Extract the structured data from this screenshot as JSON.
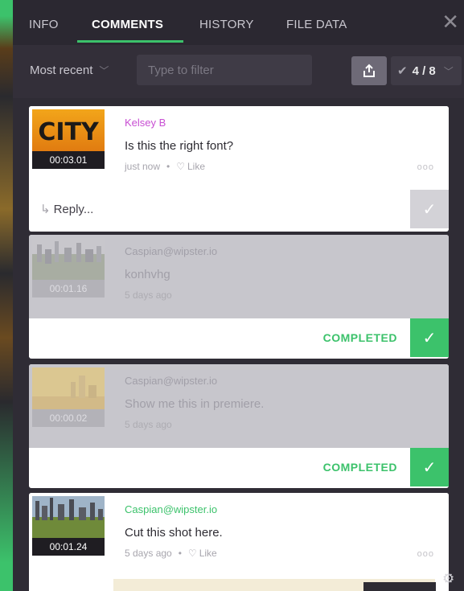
{
  "tabs": [
    {
      "label": "INFO",
      "active": false
    },
    {
      "label": "COMMENTS",
      "active": true
    },
    {
      "label": "HISTORY",
      "active": false
    },
    {
      "label": "FILE DATA",
      "active": false
    }
  ],
  "close_icon": "close-icon",
  "filter": {
    "sort_label": "Most recent",
    "placeholder": "Type to filter",
    "counter": "4 / 8"
  },
  "comments": [
    {
      "author": "Kelsey B",
      "author_color": "#c84fd3",
      "text": "Is this the right font?",
      "timecode": "00:03.01",
      "time_ago": "just now",
      "like_label": "Like",
      "thumb_text": "CITY",
      "completed": false,
      "reply_label": "Reply..."
    },
    {
      "author": "Caspian@wipster.io",
      "text": "konhvhg",
      "timecode": "00:01.16",
      "time_ago": "5 days ago",
      "completed": true,
      "status": "COMPLETED"
    },
    {
      "author": "Caspian@wipster.io",
      "text": "Show me this in premiere.",
      "timecode": "00:00.02",
      "time_ago": "5 days ago",
      "completed": true,
      "status": "COMPLETED"
    },
    {
      "author": "Caspian@wipster.io",
      "author_color": "#3cc26b",
      "text": "Cut this shot here.",
      "timecode": "00:01.24",
      "time_ago": "5 days ago",
      "like_label": "Like",
      "completed": false
    }
  ],
  "colors": {
    "accent": "#3cc26b",
    "panel": "#2f2c35"
  }
}
